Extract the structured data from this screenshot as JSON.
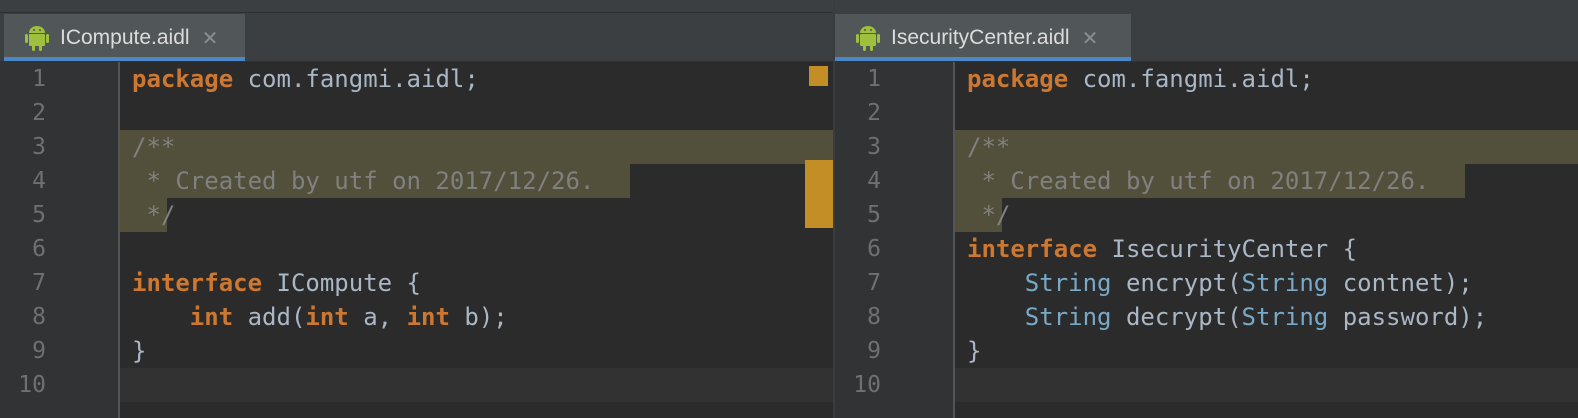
{
  "colors": {
    "background": "#2b2b2b",
    "keyword": "#cc7832",
    "comment": "#808080",
    "type": "#79a9c8",
    "doc_highlight": "#52503a",
    "tab_underline": "#4a88c7",
    "marker": "#c48e26"
  },
  "left": {
    "tab_label": "ICompute.aidl",
    "tab_icon": "android-icon",
    "line_numbers": [
      "1",
      "2",
      "3",
      "4",
      "5",
      "6",
      "7",
      "8",
      "9",
      "10"
    ],
    "lines": {
      "l1_kw": "package",
      "l1_rest": " com.fangmi.aidl;",
      "l3": "/**",
      "l4": " * Created by utf on 2017/12/26.",
      "l5": " */",
      "l7_kw": "interface",
      "l7_rest": " ICompute {",
      "l8_indent": "    ",
      "l8_kw1": "int",
      "l8_p1": " add(",
      "l8_kw2": "int",
      "l8_p2": " a, ",
      "l8_kw3": "int",
      "l8_p3": " b);",
      "l9": "}"
    }
  },
  "right": {
    "tab_label": "IsecurityCenter.aidl",
    "tab_icon": "android-icon",
    "line_numbers": [
      "1",
      "2",
      "3",
      "4",
      "5",
      "6",
      "7",
      "8",
      "9",
      "10"
    ],
    "lines": {
      "l1_kw": "package",
      "l1_rest": " com.fangmi.aidl;",
      "l3": "/**",
      "l4": " * Created by utf on 2017/12/26.",
      "l5": " */",
      "l6_kw": "interface",
      "l6_rest": " IsecurityCenter {",
      "l7_indent": "    ",
      "l7_t1": "String",
      "l7_p1": " encrypt(",
      "l7_t2": "String",
      "l7_p2": " contnet);",
      "l8_indent": "    ",
      "l8_t1": "String",
      "l8_p1": " decrypt(",
      "l8_t2": "String",
      "l8_p2": " password);",
      "l9": "}"
    }
  }
}
